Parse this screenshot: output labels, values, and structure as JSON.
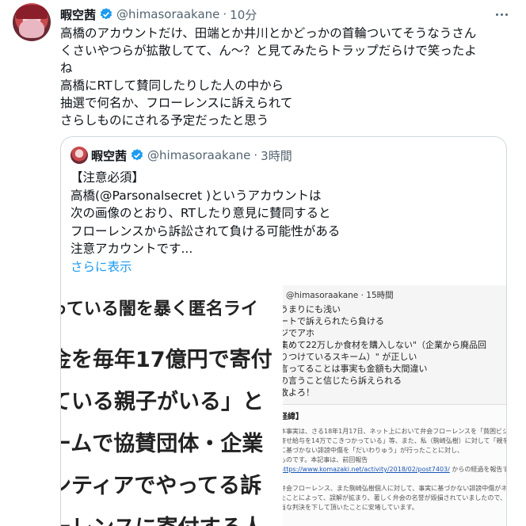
{
  "tweet": {
    "name": "暇空茜",
    "handle": "@himasoraakane",
    "separator": "·",
    "time": "10分",
    "lines": [
      "高橋のアカウントだけ、田端とか井川とかどっかの首輪ついてそうなうさん",
      "くさいやつらが拡散してて、ん〜？と見てみたらトラップだらけで笑ったよ",
      "ね",
      "高橋にRTして賛同したりした人の中から",
      "抽選で何名か、フローレンスに訴えられて",
      "さらしものにされる予定だったと思う"
    ]
  },
  "quote": {
    "name": "暇空茜",
    "handle": "@himasoraakane",
    "separator": "·",
    "time": "3時間",
    "lines": [
      "【注意必須】",
      "高橋(@Parsonalsecret )というアカウントは",
      "次の画像のとおり、RTしたり意見に賛同すると",
      "フローレンスから訴訟されて負ける可能性がある",
      "注意アカウントです..."
    ],
    "show_more": "さらに表示"
  },
  "media": {
    "left_lines": [
      "っている闇を暴く匿名ライ",
      "金を毎年17億円で寄付",
      "ている親子がいる」と",
      "ームで協賛団体・企業",
      "ンティアでやってる訴",
      "ーレンスに寄付する人"
    ],
    "right_header": "@himasoraakane · 15時間",
    "right_lines": [
      "うまりにも浅い",
      "ートで訴えられたら負ける",
      "ジでアホ",
      "集めて22万しか食材を購入しない\"（企業から廃品回",
      "りつけているスキーム）\" が正しい",
      "言ってることは事実も金額も大間違い",
      "の言うこと信じたら訴えられる",
      "散よろ！"
    ],
    "right_box_title": "経緯】",
    "right_box_lines": [
      "本事実は、さる18年1月17日、ネット上において弁会フローレンスを「貧困ビジネス」",
      "寄せ給与を14万でこきつかっている」等、また、私（駒崎弘樹）に対して「親を訴訟",
      "に基づかない誹謗中傷を「だいわりゅう」が行ったことに対し、",
      "ものです。本記事は、前回報告"
    ],
    "right_box_link": "https://www.komazaki.net/activity/2018/02/post7403/",
    "right_box_link_after": "からの経過を報告するものです。",
    "right_box_lines2": [
      "弁会フローレンス、また駒崎弘樹個人に対して、事実に基づかない誹謗中傷がネットで",
      "たことによって、誤解が拡まり、著しく弁会の名誉が毀損されていましたので、員申",
      "当な判決を下して頂いたことに安堵しています。"
    ]
  },
  "colors": {
    "accent": "#1d9bf0",
    "text": "#0f1419",
    "secondary": "#536471",
    "border": "#cfd9de"
  },
  "icons": [
    "verified-badge-icon",
    "more-options-icon"
  ]
}
